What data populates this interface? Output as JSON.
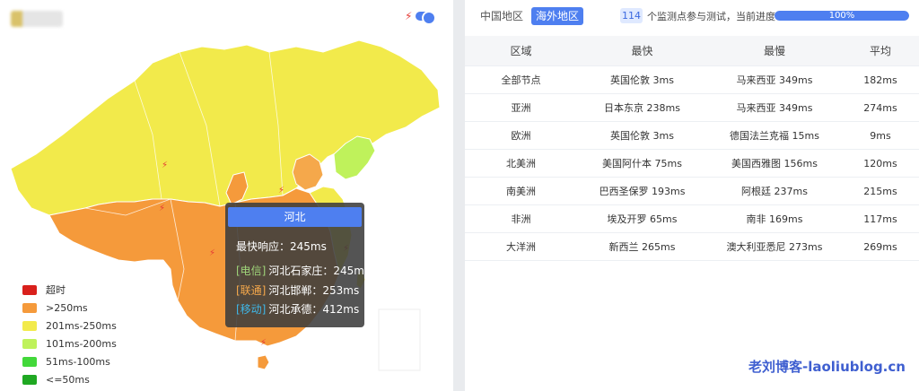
{
  "header": {
    "speed_toggle_on": true
  },
  "map": {
    "hovered_province": "河北"
  },
  "legend": [
    {
      "label": "超时",
      "color": "#d9201c"
    },
    {
      "label": ">250ms",
      "color": "#f59a3b"
    },
    {
      "label": "201ms-250ms",
      "color": "#f2ea4b"
    },
    {
      "label": "101ms-200ms",
      "color": "#bff25b"
    },
    {
      "label": "51ms-100ms",
      "color": "#42d83a"
    },
    {
      "label": "<=50ms",
      "color": "#1fa822"
    }
  ],
  "tooltip": {
    "title": "河北",
    "fastest": "最快响应：245ms",
    "lines": [
      {
        "tag": "[电信]",
        "tag_color": "#9fd47a",
        "text": "河北石家庄：245ms"
      },
      {
        "tag": "[联通]",
        "tag_color": "#f5a84b",
        "text": "河北邯郸：253ms"
      },
      {
        "tag": "[移动]",
        "tag_color": "#3fb7e8",
        "text": "河北承德：412ms"
      }
    ]
  },
  "tabs": {
    "china": "中国地区",
    "overseas": "海外地区"
  },
  "stats": {
    "count": "114",
    "text": "个监测点参与测试，当前进度：",
    "progress": 100,
    "progress_label": "100%"
  },
  "table": {
    "headers": [
      "区域",
      "最快",
      "最慢",
      "平均"
    ],
    "rows": [
      [
        "全部节点",
        "英国伦敦 3ms",
        "马来西亚 349ms",
        "182ms"
      ],
      [
        "亚洲",
        "日本东京 238ms",
        "马来西亚 349ms",
        "274ms"
      ],
      [
        "欧洲",
        "英国伦敦 3ms",
        "德国法兰克福 15ms",
        "9ms"
      ],
      [
        "北美洲",
        "美国阿什本 75ms",
        "美国西雅图 156ms",
        "120ms"
      ],
      [
        "南美洲",
        "巴西圣保罗 193ms",
        "阿根廷 237ms",
        "215ms"
      ],
      [
        "非洲",
        "埃及开罗 65ms",
        "南非 169ms",
        "117ms"
      ],
      [
        "大洋洲",
        "新西兰 265ms",
        "澳大利亚悉尼 273ms",
        "269ms"
      ]
    ]
  },
  "watermark": "老刘博客-laoliublog.cn"
}
